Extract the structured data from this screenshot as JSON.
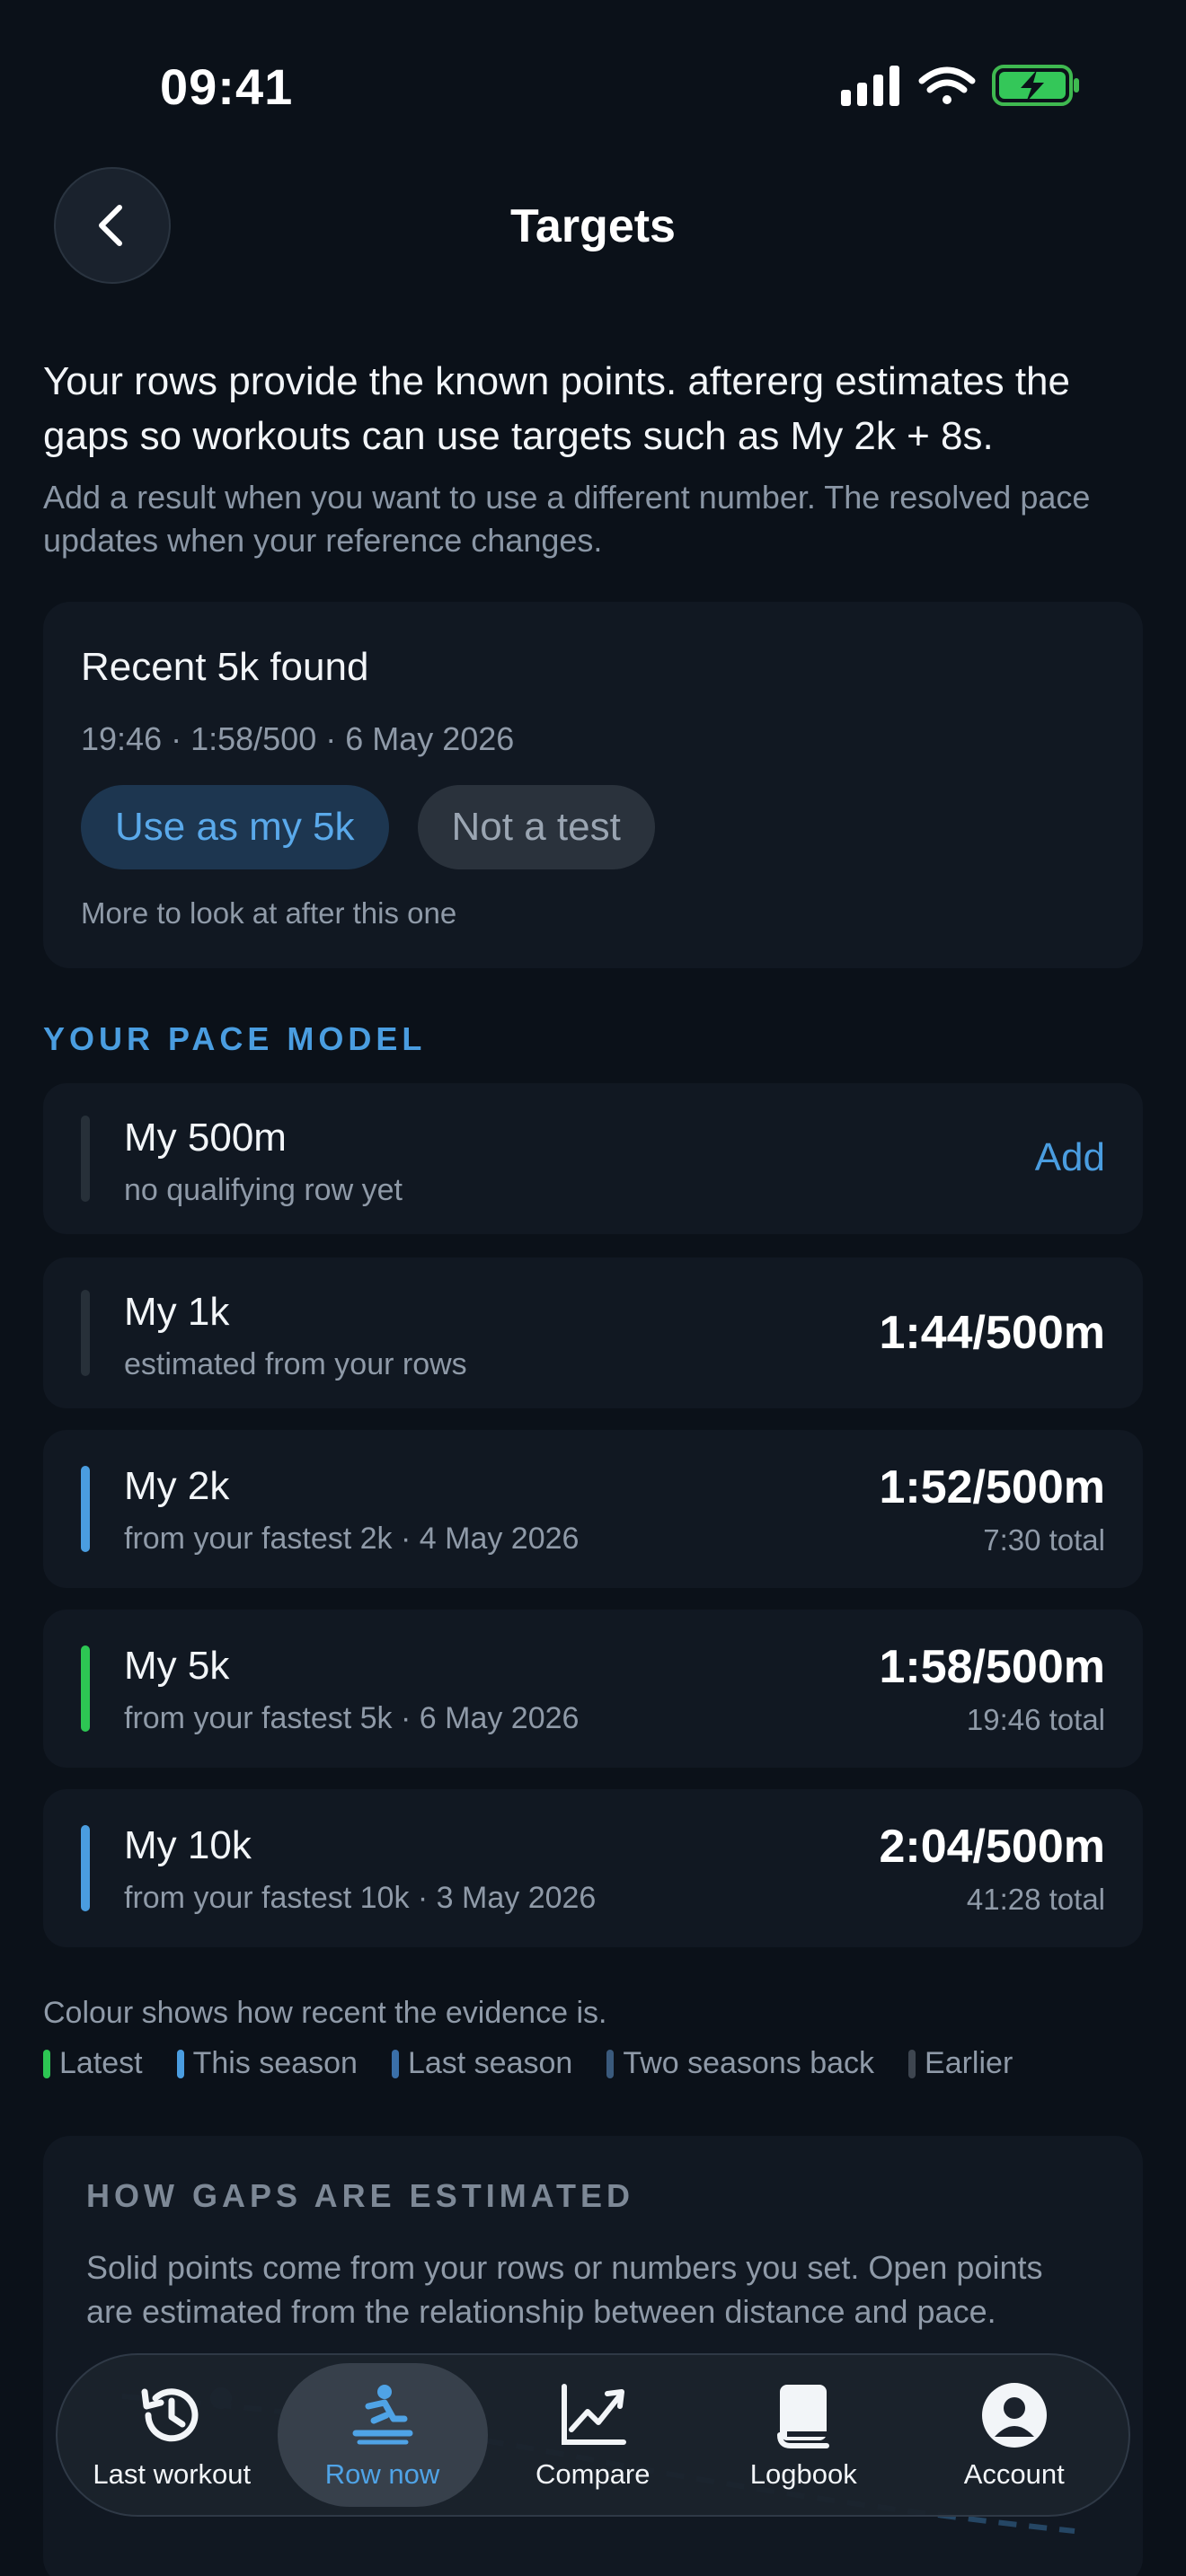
{
  "status_bar": {
    "time": "09:41"
  },
  "header": {
    "title": "Targets"
  },
  "intro": {
    "main": "Your rows provide the known points. aftererg estimates the gaps so workouts can use targets such as My 2k + 8s.",
    "sub": "Add a result when you want to use a different number. The resolved pace updates when your reference changes."
  },
  "found_card": {
    "title": "Recent 5k found",
    "meta": "19:46 · 1:58/500 · 6 May 2026",
    "primary_label": "Use as my 5k",
    "secondary_label": "Not a test",
    "more": "More to look at after this one"
  },
  "pace_model": {
    "section_label": "YOUR PACE MODEL",
    "rows": [
      {
        "name": "My 500m",
        "sub": "no qualifying row yet",
        "action": "Add",
        "color": "#273039"
      },
      {
        "name": "My 1k",
        "sub": "estimated from your rows",
        "pace": "1:44/500m",
        "color": "#273039"
      },
      {
        "name": "My 2k",
        "sub": "from your fastest 2k · 4 May 2026",
        "pace": "1:52/500m",
        "total": "7:30 total",
        "color": "#4a9de0"
      },
      {
        "name": "My 5k",
        "sub": "from your fastest 5k · 6 May 2026",
        "pace": "1:58/500m",
        "total": "19:46 total",
        "color": "#2dc653"
      },
      {
        "name": "My 10k",
        "sub": "from your fastest 10k · 3 May 2026",
        "pace": "2:04/500m",
        "total": "41:28 total",
        "color": "#4a9de0"
      }
    ]
  },
  "legend": {
    "note": "Colour shows how recent the evidence is.",
    "items": [
      {
        "label": "Latest",
        "color": "#2dc653"
      },
      {
        "label": "This season",
        "color": "#4a9de0"
      },
      {
        "label": "Last season",
        "color": "#3a6fa8"
      },
      {
        "label": "Two seasons back",
        "color": "#3a5a7c"
      },
      {
        "label": "Earlier",
        "color": "#3e4650"
      }
    ]
  },
  "estimate_card": {
    "title": "HOW GAPS ARE ESTIMATED",
    "body": "Solid points come from your rows or numbers you set. Open points are estimated from the relationship between distance and pace."
  },
  "tabs": [
    {
      "label": "Last workout",
      "icon": "history-icon"
    },
    {
      "label": "Row now",
      "icon": "rower-icon",
      "active": true
    },
    {
      "label": "Compare",
      "icon": "chart-icon"
    },
    {
      "label": "Logbook",
      "icon": "book-icon"
    },
    {
      "label": "Account",
      "icon": "account-icon"
    }
  ]
}
